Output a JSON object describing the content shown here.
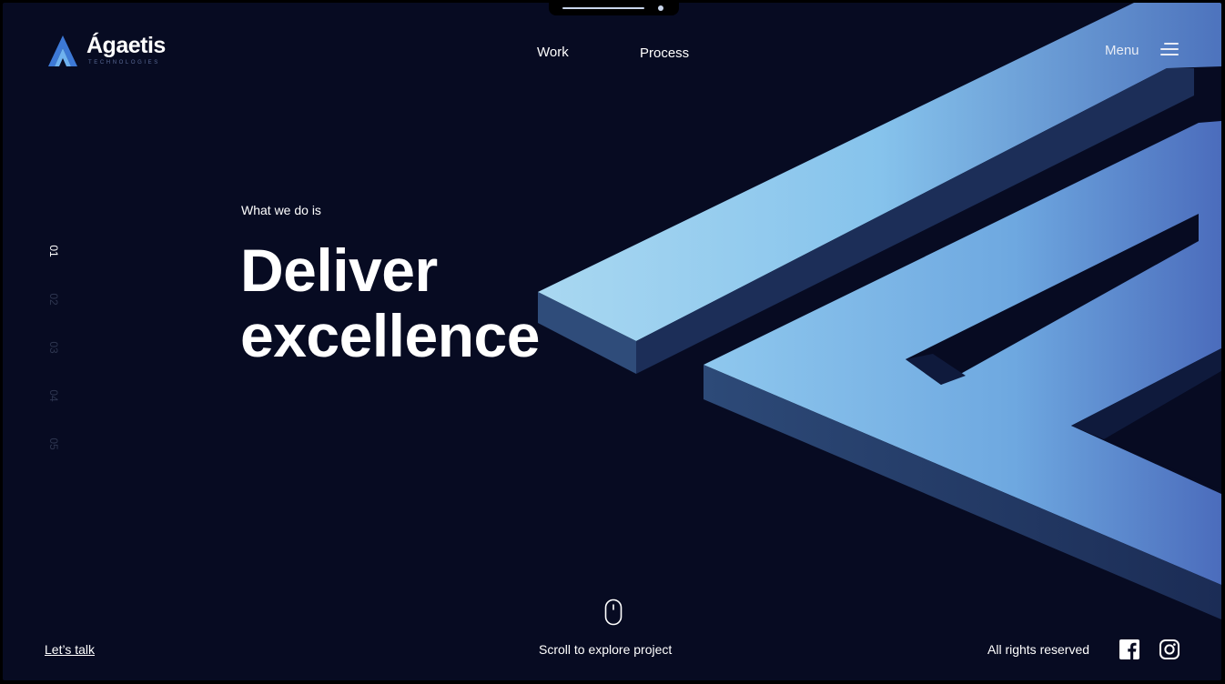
{
  "brand": {
    "name": "Ágaetis",
    "tagline": "TECHNOLOGIES",
    "icon": "triangle-a-logo"
  },
  "nav": {
    "work": "Work",
    "process": "Process",
    "menu": "Menu"
  },
  "pager": {
    "items": [
      "01",
      "02",
      "03",
      "04",
      "05"
    ],
    "active": "01"
  },
  "hero": {
    "eyebrow": "What we do is",
    "headline_line1": "Deliver",
    "headline_line2": "excellence"
  },
  "footer": {
    "cta": "Let’s talk",
    "scroll_hint": "Scroll to explore project",
    "rights": "All rights reserved",
    "social": [
      "facebook-icon",
      "instagram-icon"
    ]
  },
  "colors": {
    "background": "#070b22",
    "accent_light": "#a9d8f1",
    "accent_dark": "#4a6fc0",
    "text": "#ffffff"
  }
}
